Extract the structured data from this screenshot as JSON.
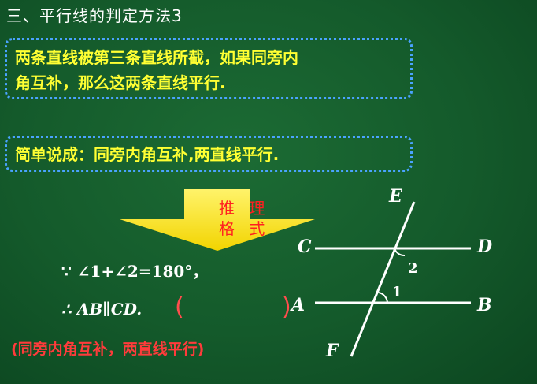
{
  "title": "三、平行线的判定方法3",
  "statement": {
    "line1": "两条直线被第三条直线所截，如果同旁内",
    "line2": "角互补，那么这两条直线平行."
  },
  "short_form": "简单说成：同旁内角互补,两直线平行.",
  "arrow": {
    "label_line1": "推 理",
    "label_line2": "格 式",
    "fill_color": "#ffe933"
  },
  "proof": {
    "because": "∵ ∠1+∠2=180°，",
    "therefore": "∴ AB∥CD.",
    "bracket_open": "(",
    "bracket_close": ")",
    "reason": "(同旁内角互补，两直线平行)"
  },
  "diagram": {
    "points": [
      "E",
      "C",
      "D",
      "A",
      "B",
      "F"
    ],
    "angle_labels": [
      "1",
      "2"
    ],
    "line_color": "#ffffff"
  },
  "colors": {
    "board": "#145a2b",
    "statement_text": "#ffff33",
    "dotted_border": "#4aa3ff",
    "reason_text": "#ff3b3b"
  }
}
